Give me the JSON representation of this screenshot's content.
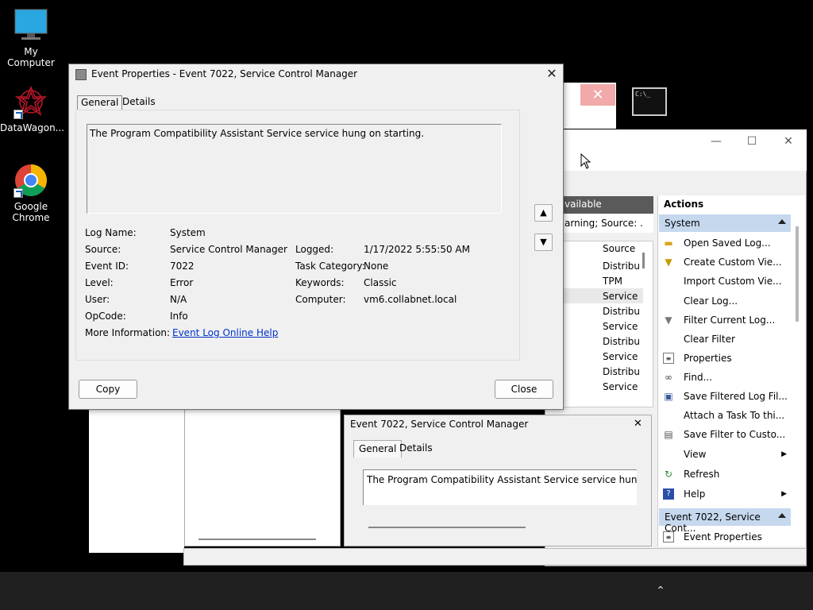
{
  "desktop": {
    "icons": [
      {
        "label": "My Computer"
      },
      {
        "label": "DataWagon..."
      },
      {
        "label": "Google Chrome"
      }
    ]
  },
  "dialog": {
    "title": "Event Properties - Event 7022, Service Control Manager",
    "tabs": [
      "General",
      "Details"
    ],
    "description": "The Program Compatibility Assistant Service service hung on starting.",
    "fields": {
      "log_name": {
        "label": "Log Name:",
        "value": "System"
      },
      "source": {
        "label": "Source:",
        "value": "Service Control Manager"
      },
      "event_id": {
        "label": "Event ID:",
        "value": "7022"
      },
      "level": {
        "label": "Level:",
        "value": "Error"
      },
      "user": {
        "label": "User:",
        "value": "N/A"
      },
      "opcode": {
        "label": "OpCode:",
        "value": "Info"
      },
      "more_info": {
        "label": "More Information:",
        "value": "Event Log Online Help"
      },
      "logged": {
        "label": "Logged:",
        "value": "1/17/2022 5:55:50 AM"
      },
      "task_category": {
        "label": "Task Category:",
        "value": "None"
      },
      "keywords": {
        "label": "Keywords:",
        "value": "Classic"
      },
      "computer": {
        "label": "Computer:",
        "value": "vm6.collabnet.local"
      }
    },
    "copy_label": "Copy",
    "close_label": "Close"
  },
  "event_viewer": {
    "list_header": "vailable",
    "list_filter": "arning; Source: .",
    "source_column": "Source",
    "source_cells": [
      "Distribut",
      "TPM",
      "Service C",
      "Distribut",
      "Service C",
      "Distribut",
      "Service C",
      "Distribut",
      "Service C"
    ],
    "actions_title": "Actions",
    "group_system": "System",
    "group_event": "Event 7022, Service Cont...",
    "actions": [
      {
        "label": "Open Saved Log...",
        "icon": "folder-icon"
      },
      {
        "label": "Create Custom Vie...",
        "icon": "filter-icon"
      },
      {
        "label": "Import Custom Vie...",
        "icon": ""
      },
      {
        "label": "Clear Log...",
        "icon": ""
      },
      {
        "label": "Filter Current Log...",
        "icon": "funnel-icon"
      },
      {
        "label": "Clear Filter",
        "icon": ""
      },
      {
        "label": "Properties",
        "icon": "properties-icon"
      },
      {
        "label": "Find...",
        "icon": "binoculars-icon"
      },
      {
        "label": "Save Filtered Log Fil...",
        "icon": "save-icon"
      },
      {
        "label": "Attach a Task To thi...",
        "icon": ""
      },
      {
        "label": "Save Filter to Custo...",
        "icon": "save-filter-icon"
      },
      {
        "label": "View",
        "icon": ""
      },
      {
        "label": "Refresh",
        "icon": "refresh-icon"
      },
      {
        "label": "Help",
        "icon": "help-icon"
      }
    ],
    "event_actions": [
      {
        "label": "Event Properties",
        "icon": "properties-icon"
      }
    ],
    "preview": {
      "title": "Event 7022, Service Control Manager",
      "tabs": [
        "General",
        "Details"
      ],
      "description": "The Program Compatibility Assistant Service service hung on st"
    }
  }
}
